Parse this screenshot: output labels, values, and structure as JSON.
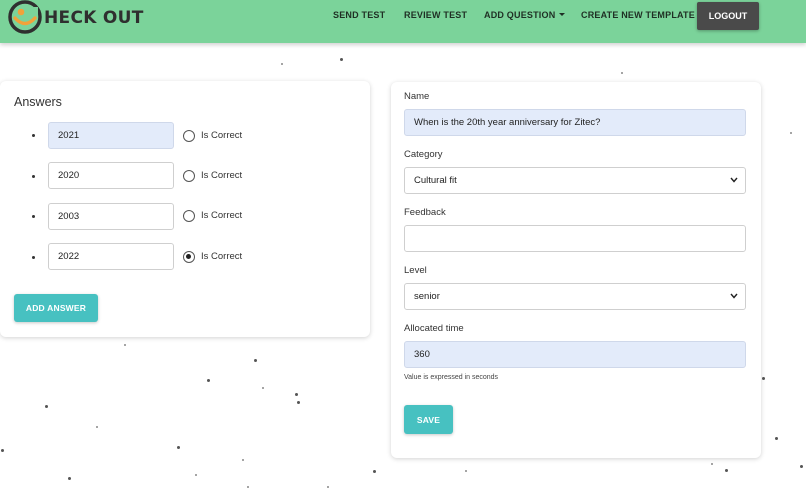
{
  "brand": {
    "name": "HECK OUT",
    "logo_icon": "smiley-check-icon"
  },
  "nav": {
    "send_test": "SEND TEST",
    "review_test": "REVIEW TEST",
    "add_question": "ADD QUESTION",
    "create_template": "CREATE NEW TEMPLATE",
    "logout": "LOGOUT"
  },
  "answers": {
    "title": "Answers",
    "items": [
      {
        "value": "2021",
        "is_correct_label": "Is Correct",
        "checked": false
      },
      {
        "value": "2020",
        "is_correct_label": "Is Correct",
        "checked": false
      },
      {
        "value": "2003",
        "is_correct_label": "Is Correct",
        "checked": false
      },
      {
        "value": "2022",
        "is_correct_label": "Is Correct",
        "checked": true
      }
    ],
    "add_button": "ADD ANSWER"
  },
  "form": {
    "name_label": "Name",
    "name_value": "When is the 20th year anniversary for Zitec?",
    "category_label": "Category",
    "category_value": "Cultural fit",
    "feedback_label": "Feedback",
    "feedback_value": "",
    "level_label": "Level",
    "level_value": "senior",
    "time_label": "Allocated time",
    "time_value": "360",
    "time_help": "Value is expressed in seconds",
    "save_button": "SAVE"
  },
  "colors": {
    "navbar": "#7bd39a",
    "accent": "#47c1c1",
    "logout": "#4a4a4a",
    "filled_input": "#e3ebfa"
  }
}
